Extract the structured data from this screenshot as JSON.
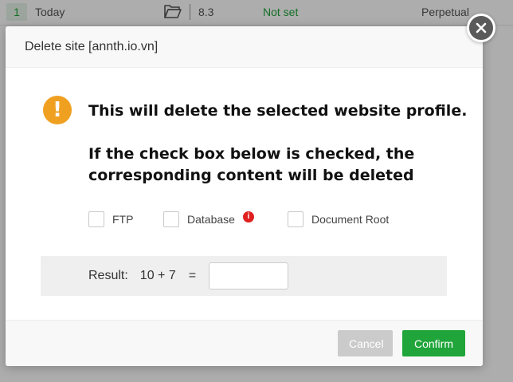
{
  "background_row": {
    "index": "1",
    "date": "Today",
    "php_version": "8.3",
    "ssl_status": "Not set",
    "expiry": "Perpetual",
    "folder_icon": "folder-open-icon"
  },
  "dialog": {
    "title": "Delete site [annth.io.vn]",
    "warning_icon": "exclamation-icon",
    "message_line1": "This will delete the selected website profile.",
    "message_line2": "If the check box below is checked, the corresponding content will be deleted",
    "options": [
      {
        "label": "FTP",
        "checked": false
      },
      {
        "label": "Database",
        "checked": false,
        "info_icon": "info-icon"
      },
      {
        "label": "Document Root",
        "checked": false
      }
    ],
    "captcha": {
      "label": "Result:",
      "expression": "10 + 7",
      "equals": "=",
      "value": ""
    },
    "buttons": {
      "cancel": "Cancel",
      "confirm": "Confirm"
    },
    "close_icon": "close-icon"
  },
  "colors": {
    "accent_green": "#20a53a",
    "warning_orange": "#f0a020",
    "info_red": "#e02020",
    "cancel_gray": "#cbcbcb"
  }
}
